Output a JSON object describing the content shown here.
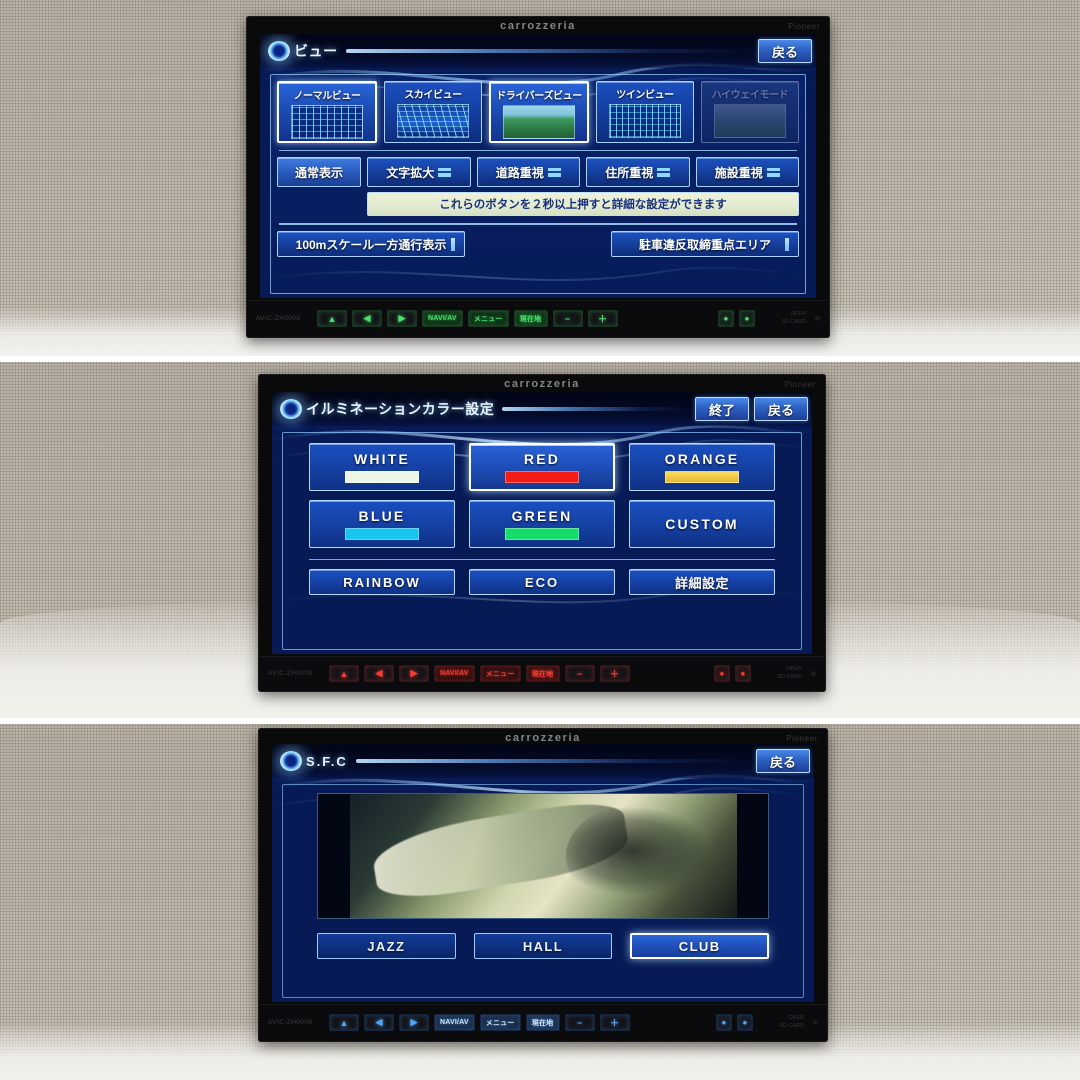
{
  "device": {
    "brand": "carrozzeria",
    "sub_brand": "Pioneer",
    "model_text": "AVIC-ZH0009"
  },
  "panels": [
    {
      "id": "view-settings",
      "header": {
        "title": "ビュー",
        "orb_icon": "glow-orb-icon",
        "buttons": [
          {
            "label": "戻る",
            "name": "back-button"
          }
        ]
      },
      "view_modes": [
        {
          "label": "ノーマルビュー",
          "thumb": "normal",
          "selected": false,
          "disabled": false
        },
        {
          "label": "スカイビュー",
          "thumb": "sky",
          "selected": false,
          "disabled": false
        },
        {
          "label": "ドライバーズビュー",
          "thumb": "driver",
          "selected": true,
          "disabled": false
        },
        {
          "label": "ツインビュー",
          "thumb": "twin",
          "selected": false,
          "disabled": false
        },
        {
          "label": "ハイウェイモード",
          "thumb": "highway",
          "selected": false,
          "disabled": true
        }
      ],
      "display_main": {
        "label": "通常表示",
        "selected": true
      },
      "display_modes": [
        {
          "label": "文字拡大",
          "toggle": true
        },
        {
          "label": "道路重視",
          "toggle": true
        },
        {
          "label": "住所重視",
          "toggle": true
        },
        {
          "label": "施設重視",
          "toggle": true
        }
      ],
      "hint": "これらのボタンを２秒以上押すと詳細な設定ができます",
      "wide_buttons": [
        {
          "label": "100mスケール一方通行表示"
        },
        {
          "label": "駐車違反取締重点エリア"
        }
      ],
      "illumination": "green"
    },
    {
      "id": "illumination-colour",
      "header": {
        "title": "イルミネーションカラー設定",
        "orb_icon": "glow-orb-icon",
        "buttons": [
          {
            "label": "終了",
            "name": "finish-button"
          },
          {
            "label": "戻る",
            "name": "back-button"
          }
        ]
      },
      "colours": [
        {
          "label": "WHITE",
          "swatch": "#eef6e6",
          "selected": false,
          "japanese": false
        },
        {
          "label": "RED",
          "swatch": "#f41c16",
          "selected": true,
          "japanese": false
        },
        {
          "label": "ORANGE",
          "swatch": "#f5c93c",
          "selected": false,
          "japanese": false
        },
        {
          "label": "BLUE",
          "swatch": "#19c4f0",
          "selected": false,
          "japanese": false
        },
        {
          "label": "GREEN",
          "swatch": "#16dc6a",
          "selected": false,
          "japanese": false
        },
        {
          "label": "CUSTOM",
          "swatch": null,
          "selected": false,
          "japanese": false
        }
      ],
      "extra_buttons": [
        {
          "label": "RAINBOW",
          "japanese": false
        },
        {
          "label": "ECO",
          "japanese": false
        },
        {
          "label": "詳細設定",
          "japanese": true
        }
      ],
      "illumination": "red"
    },
    {
      "id": "sfc-sound-field",
      "header": {
        "title": "S.F.C",
        "orb_icon": "glow-orb-icon",
        "buttons": [
          {
            "label": "戻る",
            "name": "back-button"
          }
        ]
      },
      "video": {
        "alt": "turntable-video-preview"
      },
      "sound_fields": [
        {
          "label": "JAZZ",
          "selected": false
        },
        {
          "label": "HALL",
          "selected": false
        },
        {
          "label": "CLUB",
          "selected": true
        }
      ],
      "illumination": "blue"
    }
  ],
  "hard_keys": {
    "items": [
      {
        "name": "eject-key",
        "glyph": "▲",
        "kind": "icon"
      },
      {
        "name": "track-prev-key",
        "glyph": "◀",
        "kind": "icon"
      },
      {
        "name": "track-next-key",
        "glyph": "▶",
        "kind": "icon"
      },
      {
        "name": "navi-av-key",
        "label": "NAVI/AV",
        "kind": "txt"
      },
      {
        "name": "menu-key",
        "label": "メニュー",
        "kind": "txt"
      },
      {
        "name": "current-location-key",
        "label": "現在地",
        "kind": "txt"
      },
      {
        "name": "volume-down-key",
        "glyph": "−",
        "kind": "icon"
      },
      {
        "name": "volume-up-key",
        "glyph": "＋",
        "kind": "icon"
      },
      {
        "name": "open-close-lamp",
        "glyph": "●",
        "kind": "lamp"
      },
      {
        "name": "reset-lamp",
        "glyph": "●",
        "kind": "lamp"
      }
    ],
    "tail_line1": "OPEN",
    "tail_line2": "SD CARD"
  },
  "colors": {
    "screen_blue": "#0a2270",
    "accent_cyan": "#8fd8ff",
    "button_border": "#a9d4ff",
    "illum_green": "#46e36a",
    "illum_red": "#ff3b30",
    "illum_blue": "#4fa8ff"
  }
}
